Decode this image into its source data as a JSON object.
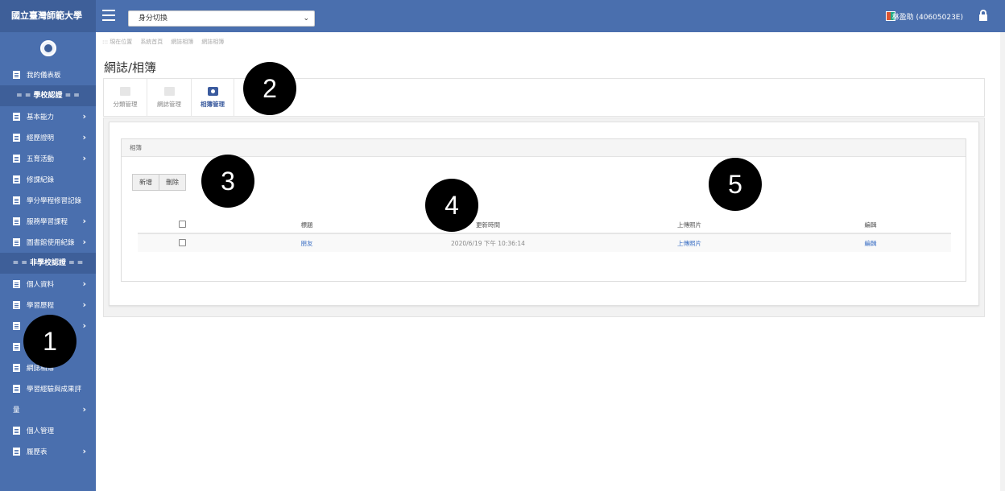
{
  "sidebar": {
    "brand": "國立臺灣師範大學",
    "items": [
      {
        "label": "我的儀表板",
        "chev": ""
      },
      {
        "sep": "= = 學校認證 = ="
      },
      {
        "label": "基本能力",
        "chev": "›"
      },
      {
        "label": "經歷證明",
        "chev": "›"
      },
      {
        "label": "五育活動",
        "chev": "›"
      },
      {
        "label": "修課紀錄",
        "chev": ""
      },
      {
        "label": "學分學程修習記錄",
        "chev": ""
      },
      {
        "label": "服務學習課程",
        "chev": "›"
      },
      {
        "label": "圖書館使用紀錄",
        "chev": "›"
      },
      {
        "sep": "= = 非學校認證 = ="
      },
      {
        "label": "個人資料",
        "chev": "›"
      },
      {
        "label": "學習歷程",
        "chev": "›"
      },
      {
        "label": "",
        "chev": "›"
      },
      {
        "label": "",
        "chev": ""
      },
      {
        "label": "網誌相簿",
        "chev": ""
      },
      {
        "label": "學習經驗與成果評",
        "chev": ""
      },
      {
        "label": "量",
        "chev": "›",
        "noicon": true
      },
      {
        "label": "個人管理",
        "chev": ""
      },
      {
        "label": "履歷表",
        "chev": "›"
      }
    ]
  },
  "topbar": {
    "role_select": "身分切換",
    "user": "林盈助 (40605023E)"
  },
  "breadcrumb": [
    "::: 現在位置",
    "系統首頁",
    "網誌相簿",
    "網誌相簿"
  ],
  "page_title": "網誌/相簿",
  "tabs": [
    {
      "label": "分類管理"
    },
    {
      "label": "網誌管理"
    },
    {
      "label": "相簿管理"
    }
  ],
  "album": {
    "header": "相簿",
    "add_label": "新增",
    "delete_label": "刪除",
    "columns": [
      "標題",
      "更新時間",
      "上傳照片",
      "編輯"
    ],
    "rows": [
      {
        "title": "朋友",
        "updated": "2020/6/19 下午 10:36:14",
        "upload": "上傳照片",
        "edit": "編輯"
      }
    ]
  },
  "markers": [
    "1",
    "2",
    "3",
    "4",
    "5"
  ]
}
